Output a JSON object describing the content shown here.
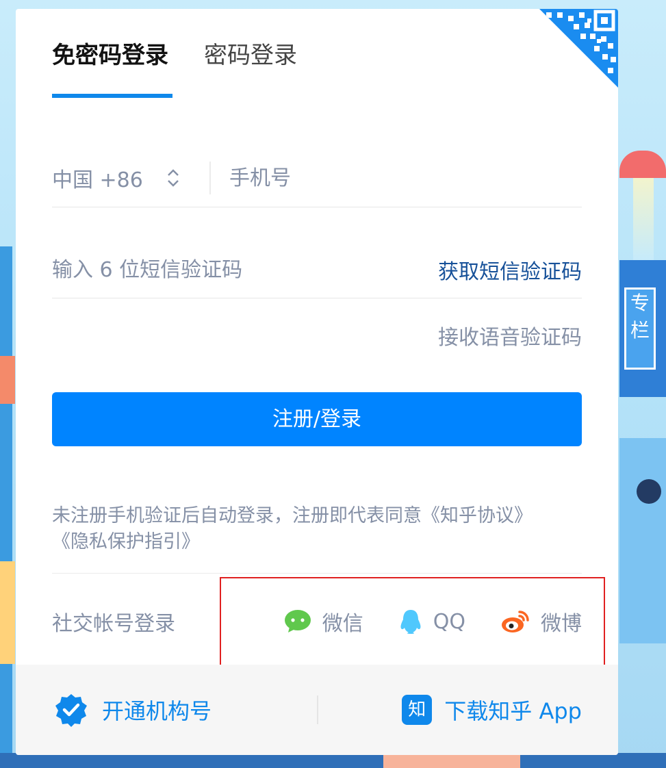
{
  "tabs": [
    {
      "label": "免密码登录",
      "active": true
    },
    {
      "label": "密码登录",
      "active": false
    }
  ],
  "phone": {
    "country": "中国 +86",
    "placeholder": "手机号"
  },
  "code": {
    "placeholder": "输入 6 位短信验证码",
    "get_code_label": "获取短信验证码"
  },
  "voice_code_label": "接收语音验证码",
  "submit_label": "注册/登录",
  "terms": {
    "line1": "未注册手机验证后自动登录，注册即代表同意《知乎协议》",
    "line2": "《隐私保护指引》"
  },
  "social": {
    "label": "社交帐号登录",
    "items": [
      {
        "name": "wechat",
        "label": "微信",
        "icon": "wechat-icon",
        "color": "#60c84d"
      },
      {
        "name": "qq",
        "label": "QQ",
        "icon": "qq-icon",
        "color": "#50c8fd"
      },
      {
        "name": "weibo",
        "label": "微博",
        "icon": "weibo-icon",
        "color": "#fb6622"
      }
    ]
  },
  "footer": {
    "org_label": "开通机构号",
    "zhi_badge": "知",
    "download_label": "下载知乎 App"
  },
  "colors": {
    "primary": "#0084ff",
    "link": "#175199",
    "muted": "#8590a6",
    "highlight_box": "#e02020"
  }
}
